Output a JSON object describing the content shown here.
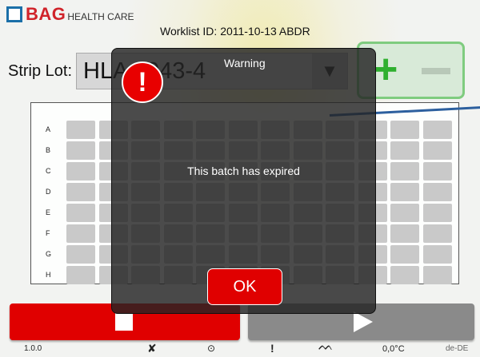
{
  "brand": {
    "name": "BAG",
    "subtitle": "HEALTH CARE"
  },
  "header": {
    "worklist": "Worklist ID: 2011-10-13 ABDR"
  },
  "strip_lot": {
    "label": "Strip Lot:",
    "value": "HLA 1043-4",
    "dropdown_icon": "triangle-down-icon"
  },
  "plus_minus": {
    "plus_icon": "plus-icon",
    "minus_icon": "minus-icon"
  },
  "plate": {
    "rows": [
      "A",
      "B",
      "C",
      "D",
      "E",
      "F",
      "G",
      "H"
    ],
    "columns": 12
  },
  "controls": {
    "stop_icon": "stop-icon",
    "play_icon": "play-icon",
    "stop_color": "#e00000",
    "play_color": "#8a8a8a"
  },
  "status": {
    "version": "1.0.0",
    "temperature": "0,0°C",
    "locale": "de-DE"
  },
  "dialog": {
    "title": "Warning",
    "message": "This batch has expired",
    "ok_label": "OK",
    "icon_glyph": "!"
  }
}
